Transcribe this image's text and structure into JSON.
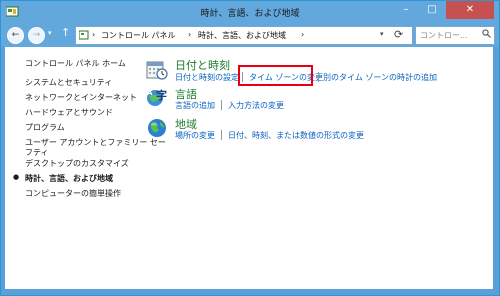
{
  "window": {
    "title": "時計、言語、および地域",
    "min_label": "–",
    "max_label": "□",
    "close_label": "✕"
  },
  "address": {
    "back_label": "←",
    "forward_label": "→",
    "recent_label": "▾",
    "up_label": "↑",
    "breadcrumb": [
      {
        "label": "›"
      },
      {
        "label": "コントロール パネル"
      },
      {
        "label": "›"
      },
      {
        "label": "時計、言語、および地域"
      },
      {
        "label": "›"
      }
    ],
    "dropdown_label": "▾",
    "refresh_label": "⟳",
    "search_placeholder": "コントロー..."
  },
  "sidebar": {
    "items": [
      {
        "label": "コントロール パネル ホーム"
      },
      {
        "label": "システムとセキュリティ"
      },
      {
        "label": "ネットワークとインターネット"
      },
      {
        "label": "ハードウェアとサウンド"
      },
      {
        "label": "プログラム"
      },
      {
        "label": "ユーザー アカウントとファミリー セー"
      },
      {
        "label": "フティ"
      },
      {
        "label": "デスクトップのカスタマイズ"
      },
      {
        "label": "時計、言語、および地域",
        "bullet": "●"
      },
      {
        "label": "コンピューターの簡単操作"
      }
    ]
  },
  "categories": [
    {
      "title": "日付と時刻",
      "icon": "calendar-clock-icon",
      "links": [
        "日付と時刻の設定",
        "タイム ゾーンの変更",
        "別のタイム ゾーンの時計の追加"
      ]
    },
    {
      "title": "言語",
      "icon": "language-icon",
      "links": [
        "言語の追加",
        "入力方法の変更"
      ]
    },
    {
      "title": "地域",
      "icon": "globe-icon",
      "links": [
        "場所の変更",
        "日付、時刻、または数値の形式の変更"
      ]
    }
  ],
  "colors": {
    "titlebar": "#62a8dc",
    "link": "#0a60c2",
    "category_title": "#1e7b2e",
    "highlight": "#e60012"
  }
}
